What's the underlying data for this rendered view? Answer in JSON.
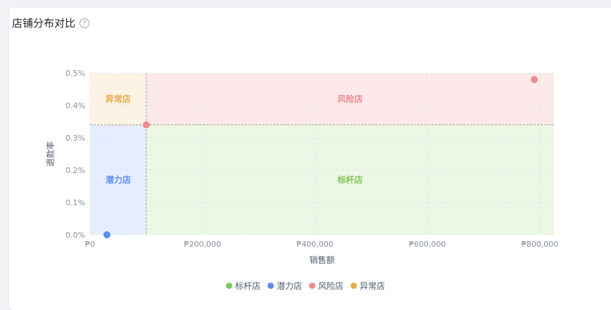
{
  "card": {
    "title": "店铺分布对比",
    "help_icon": "question-circle-icon"
  },
  "chart_data": {
    "type": "scatter",
    "xlabel": "销售额",
    "ylabel": "退款率",
    "xlim": [
      0,
      825000
    ],
    "ylim": [
      0,
      0.5
    ],
    "x_ticks": [
      {
        "value": 0,
        "label": "₱0"
      },
      {
        "value": 200000,
        "label": "₱200,000"
      },
      {
        "value": 400000,
        "label": "₱400,000"
      },
      {
        "value": 600000,
        "label": "₱600,000"
      },
      {
        "value": 800000,
        "label": "₱800,000"
      }
    ],
    "y_ticks": [
      {
        "value": 0.0,
        "label": "0.0%"
      },
      {
        "value": 0.1,
        "label": "0.1%"
      },
      {
        "value": 0.2,
        "label": "0.2%"
      },
      {
        "value": 0.3,
        "label": "0.3%"
      },
      {
        "value": 0.4,
        "label": "0.4%"
      },
      {
        "value": 0.5,
        "label": "0.5%"
      }
    ],
    "threshold": {
      "x": 100000,
      "y": 0.34
    },
    "quadrants": [
      {
        "key": "abnormal",
        "label": "异常店",
        "x": [
          0,
          100000
        ],
        "y": [
          0.34,
          0.5
        ],
        "fill": "#fdf3e4",
        "text_color": "#e8a94a",
        "label_at": [
          50000,
          0.42
        ]
      },
      {
        "key": "risk",
        "label": "风险店",
        "x": [
          100000,
          825000
        ],
        "y": [
          0.34,
          0.5
        ],
        "fill": "#fde9ea",
        "text_color": "#f08a8f",
        "label_at": [
          462500,
          0.42
        ]
      },
      {
        "key": "potential",
        "label": "潜力店",
        "x": [
          0,
          100000
        ],
        "y": [
          0,
          0.34
        ],
        "fill": "#e6edff",
        "text_color": "#5b8def",
        "label_at": [
          50000,
          0.17
        ]
      },
      {
        "key": "benchmark",
        "label": "标杆店",
        "x": [
          100000,
          825000
        ],
        "y": [
          0,
          0.34
        ],
        "fill": "#edf7e6",
        "text_color": "#7fc65a",
        "label_at": [
          462500,
          0.17
        ]
      }
    ],
    "series": [
      {
        "name": "标杆店",
        "color": "#7fc65a",
        "points": []
      },
      {
        "name": "潜力店",
        "color": "#5b8def",
        "points": [
          {
            "x": 30000,
            "y": 0.0
          }
        ]
      },
      {
        "name": "风险店",
        "color": "#f08a8f",
        "points": [
          {
            "x": 100000,
            "y": 0.34
          },
          {
            "x": 790000,
            "y": 0.48
          }
        ]
      },
      {
        "name": "异常店",
        "color": "#e8a94a",
        "points": []
      }
    ],
    "legend_position": "bottom",
    "grid": true
  }
}
